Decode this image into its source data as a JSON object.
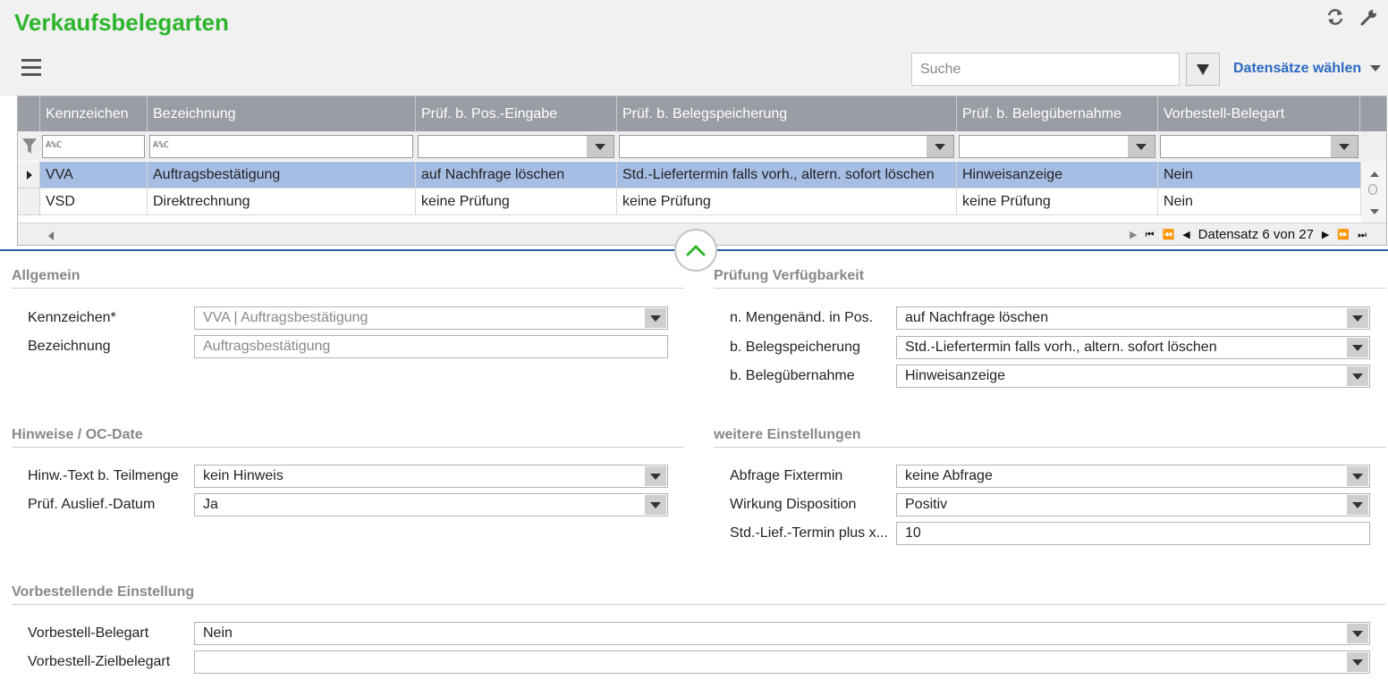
{
  "app": {
    "title": "Verkaufsbelegarten",
    "search_placeholder": "Suche",
    "select_records_label": "Datensätze wählen"
  },
  "grid": {
    "columns": [
      "Kennzeichen",
      "Bezeichnung",
      "Prüf. b. Pos.-Eingabe",
      "Prüf. b. Belegspeicherung",
      "Prüf. b. Belegübernahme",
      "Vorbestell-Belegart"
    ],
    "filter_text_marker": "A%C",
    "rows": [
      [
        "VVA",
        "Auftragsbestätigung",
        "auf Nachfrage löschen",
        "Std.-Liefertermin falls vorh., altern. sofort löschen",
        "Hinweisanzeige",
        "Nein"
      ],
      [
        "VSD",
        "Direktrechnung",
        "keine Prüfung",
        "keine Prüfung",
        "keine Prüfung",
        "Nein"
      ]
    ],
    "selected_row": 0,
    "pager": "Datensatz 6 von 27"
  },
  "form": {
    "allgemein": {
      "title": "Allgemein",
      "kennzeichen_label": "Kennzeichen*",
      "kennzeichen_value": "VVA  |  Auftragsbestätigung",
      "bezeichnung_label": "Bezeichnung",
      "bezeichnung_value": "Auftragsbestätigung"
    },
    "pruefung": {
      "title": "Prüfung Verfügbarkeit",
      "menge_label": "n. Mengenänd. in Pos.",
      "menge_value": "auf Nachfrage löschen",
      "speicher_label": "b. Belegspeicherung",
      "speicher_value": "Std.-Liefertermin falls vorh., altern. sofort löschen",
      "uebernahme_label": "b. Belegübernahme",
      "uebernahme_value": "Hinweisanzeige"
    },
    "hinweise": {
      "title": "Hinweise / OC-Date",
      "teilmenge_label": "Hinw.-Text b. Teilmenge",
      "teilmenge_value": "kein Hinweis",
      "auslief_label": "Prüf. Auslief.-Datum",
      "auslief_value": "Ja"
    },
    "weitere": {
      "title": "weitere Einstellungen",
      "fixtermin_label": "Abfrage Fixtermin",
      "fixtermin_value": "keine Abfrage",
      "dispo_label": "Wirkung Disposition",
      "dispo_value": "Positiv",
      "liefplus_label": "Std.-Lief.-Termin plus x...",
      "liefplus_value": "10"
    },
    "vorbestellend": {
      "title": "Vorbestellende Einstellung",
      "belegart_label": "Vorbestell-Belegart",
      "belegart_value": "Nein",
      "ziel_label": "Vorbestell-Zielbelegart",
      "ziel_value": ""
    }
  },
  "colors": {
    "title_green": "#2db52d",
    "link_blue": "#2a6ac2",
    "header_gray": "#9a9da3",
    "selected_row": "#a6bde4",
    "divider_blue": "#2d5aa8"
  },
  "icons": [
    "refresh-icon",
    "wrench-icon",
    "menu-icon",
    "filter-icon",
    "chevron-up-icon"
  ]
}
